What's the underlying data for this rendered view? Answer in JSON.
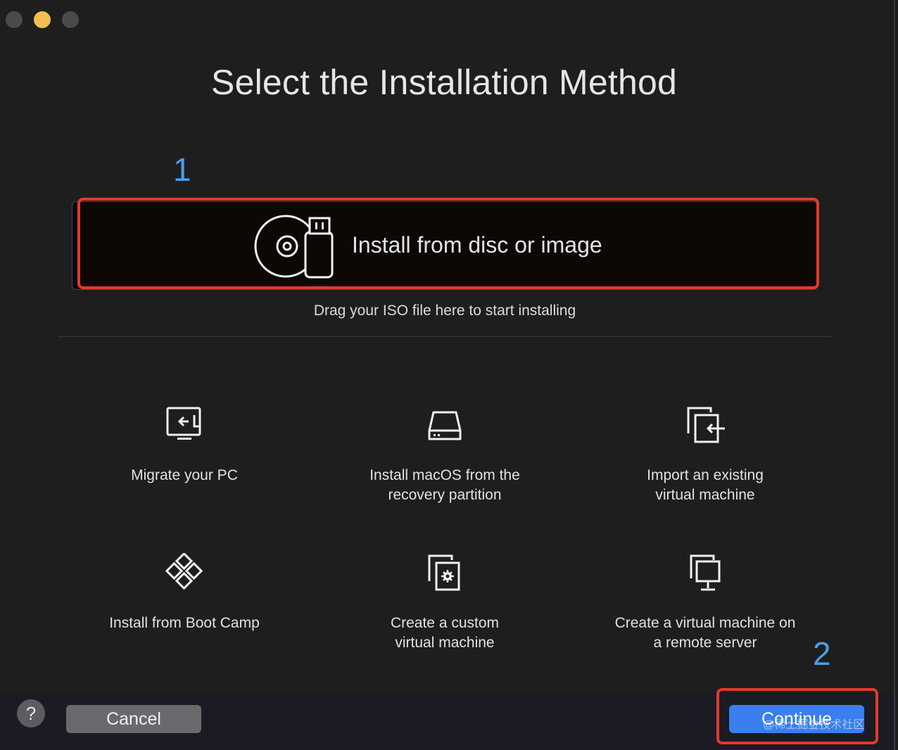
{
  "title": "Select the Installation Method",
  "annotations": {
    "step1": "1",
    "step2": "2"
  },
  "primary_option": {
    "label": "Install from disc or image",
    "hint": "Drag your ISO file here to start installing",
    "icon": "disc-usb-icon"
  },
  "options": [
    {
      "label": "Migrate your PC",
      "icon": "migrate-pc-icon"
    },
    {
      "label": "Install macOS from the\nrecovery partition",
      "icon": "drive-icon"
    },
    {
      "label": "Import an existing\nvirtual machine",
      "icon": "import-vm-icon"
    },
    {
      "label": "Install from Boot Camp",
      "icon": "bootcamp-icon"
    },
    {
      "label": "Create a custom\nvirtual machine",
      "icon": "custom-vm-icon"
    },
    {
      "label": "Create a virtual machine on\na remote server",
      "icon": "remote-server-icon"
    }
  ],
  "footer": {
    "help": "?",
    "cancel": "Cancel",
    "continue": "Continue",
    "watermark": "@稀土掘金技术社区"
  },
  "colors": {
    "background": "#1e1e1f",
    "accent": "#3a7ef0",
    "annotation": "#4a9ee8",
    "highlight": "#e23a2a"
  }
}
